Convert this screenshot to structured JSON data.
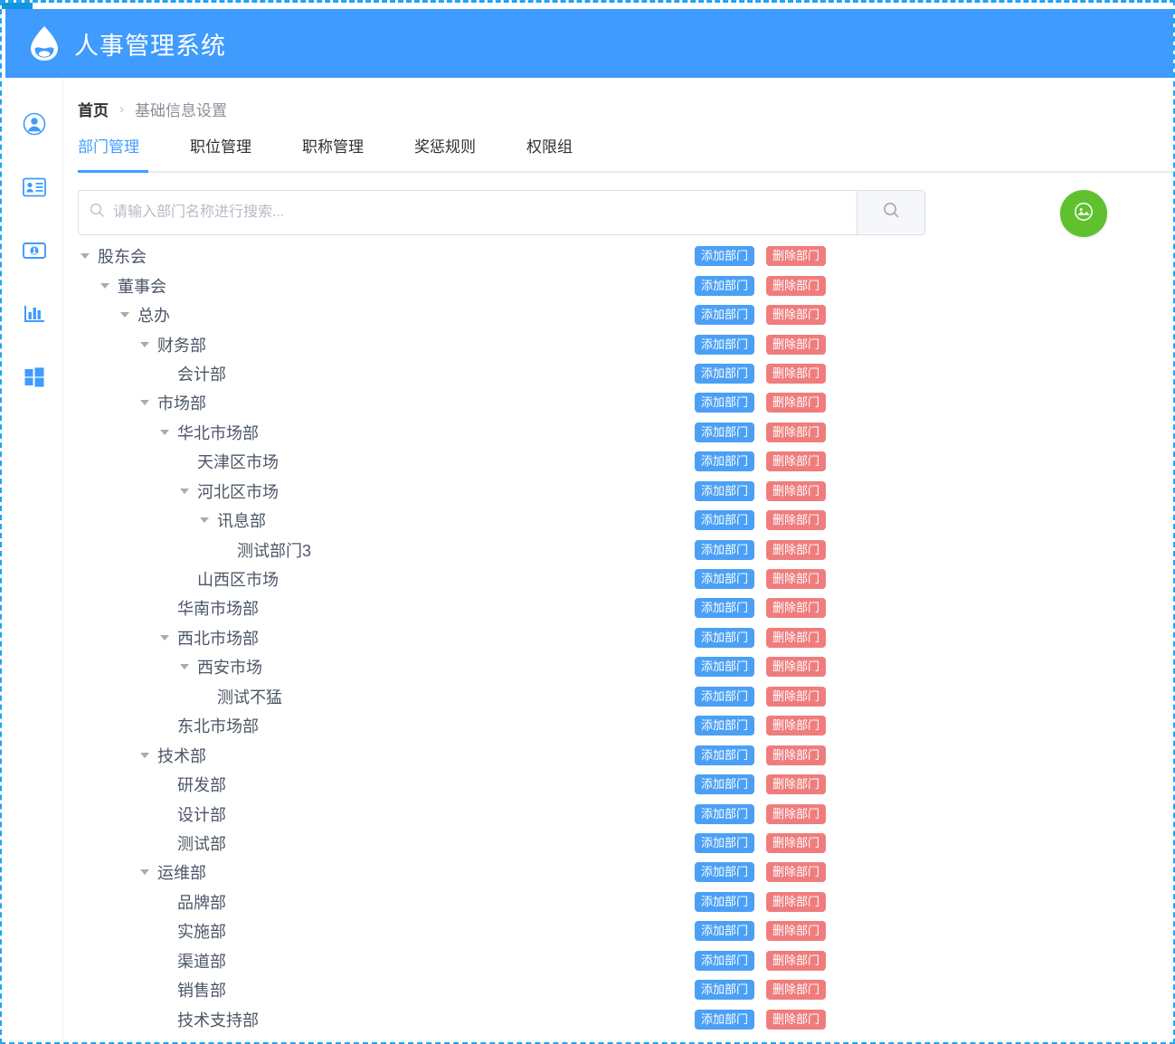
{
  "app": {
    "title": "人事管理系统",
    "logo_icon": "droplet-logo-icon",
    "header_color": "#3f9bfd"
  },
  "sidebar": {
    "items": [
      {
        "icon": "user-circle-icon",
        "name": "sidebar-item-user"
      },
      {
        "icon": "id-card-icon",
        "name": "sidebar-item-id-card"
      },
      {
        "icon": "banknote-icon",
        "name": "sidebar-item-payroll"
      },
      {
        "icon": "bar-chart-icon",
        "name": "sidebar-item-reports"
      },
      {
        "icon": "windows-grid-icon",
        "name": "sidebar-item-apps"
      }
    ]
  },
  "breadcrumb": {
    "home": "首页",
    "separator": "›",
    "current": "基础信息设置"
  },
  "tabs": {
    "active_index": 0,
    "items": [
      {
        "label": "部门管理"
      },
      {
        "label": "职位管理"
      },
      {
        "label": "职称管理"
      },
      {
        "label": "奖惩规则"
      },
      {
        "label": "权限组"
      }
    ]
  },
  "search": {
    "placeholder": "请输入部门名称进行搜索...",
    "value": "",
    "input_icon": "search-icon",
    "button_icon": "search-icon"
  },
  "fab": {
    "icon": "image-picture-icon",
    "color": "#5fc12e"
  },
  "actions": {
    "add_label": "添加部门",
    "delete_label": "删除部门",
    "add_color": "#4ba0f5",
    "delete_color": "#ef7d7d"
  },
  "tree": {
    "nodes": [
      {
        "label": "股东会",
        "depth": 0,
        "expandable": true
      },
      {
        "label": "董事会",
        "depth": 1,
        "expandable": true
      },
      {
        "label": "总办",
        "depth": 2,
        "expandable": true
      },
      {
        "label": "财务部",
        "depth": 3,
        "expandable": true
      },
      {
        "label": "会计部",
        "depth": 4,
        "expandable": false
      },
      {
        "label": "市场部",
        "depth": 3,
        "expandable": true
      },
      {
        "label": "华北市场部",
        "depth": 4,
        "expandable": true
      },
      {
        "label": "天津区市场",
        "depth": 5,
        "expandable": false
      },
      {
        "label": "河北区市场",
        "depth": 5,
        "expandable": true
      },
      {
        "label": "讯息部",
        "depth": 6,
        "expandable": true
      },
      {
        "label": "测试部门3",
        "depth": 7,
        "expandable": false
      },
      {
        "label": "山西区市场",
        "depth": 5,
        "expandable": false
      },
      {
        "label": "华南市场部",
        "depth": 4,
        "expandable": false
      },
      {
        "label": "西北市场部",
        "depth": 4,
        "expandable": true
      },
      {
        "label": "西安市场",
        "depth": 5,
        "expandable": true
      },
      {
        "label": "测试不猛",
        "depth": 6,
        "expandable": false
      },
      {
        "label": "东北市场部",
        "depth": 4,
        "expandable": false
      },
      {
        "label": "技术部",
        "depth": 3,
        "expandable": true
      },
      {
        "label": "研发部",
        "depth": 4,
        "expandable": false
      },
      {
        "label": "设计部",
        "depth": 4,
        "expandable": false
      },
      {
        "label": "测试部",
        "depth": 4,
        "expandable": false
      },
      {
        "label": "运维部",
        "depth": 3,
        "expandable": true
      },
      {
        "label": "品牌部",
        "depth": 4,
        "expandable": false
      },
      {
        "label": "实施部",
        "depth": 4,
        "expandable": false
      },
      {
        "label": "渠道部",
        "depth": 4,
        "expandable": false
      },
      {
        "label": "销售部",
        "depth": 4,
        "expandable": false
      },
      {
        "label": "技术支持部",
        "depth": 4,
        "expandable": false
      }
    ]
  }
}
